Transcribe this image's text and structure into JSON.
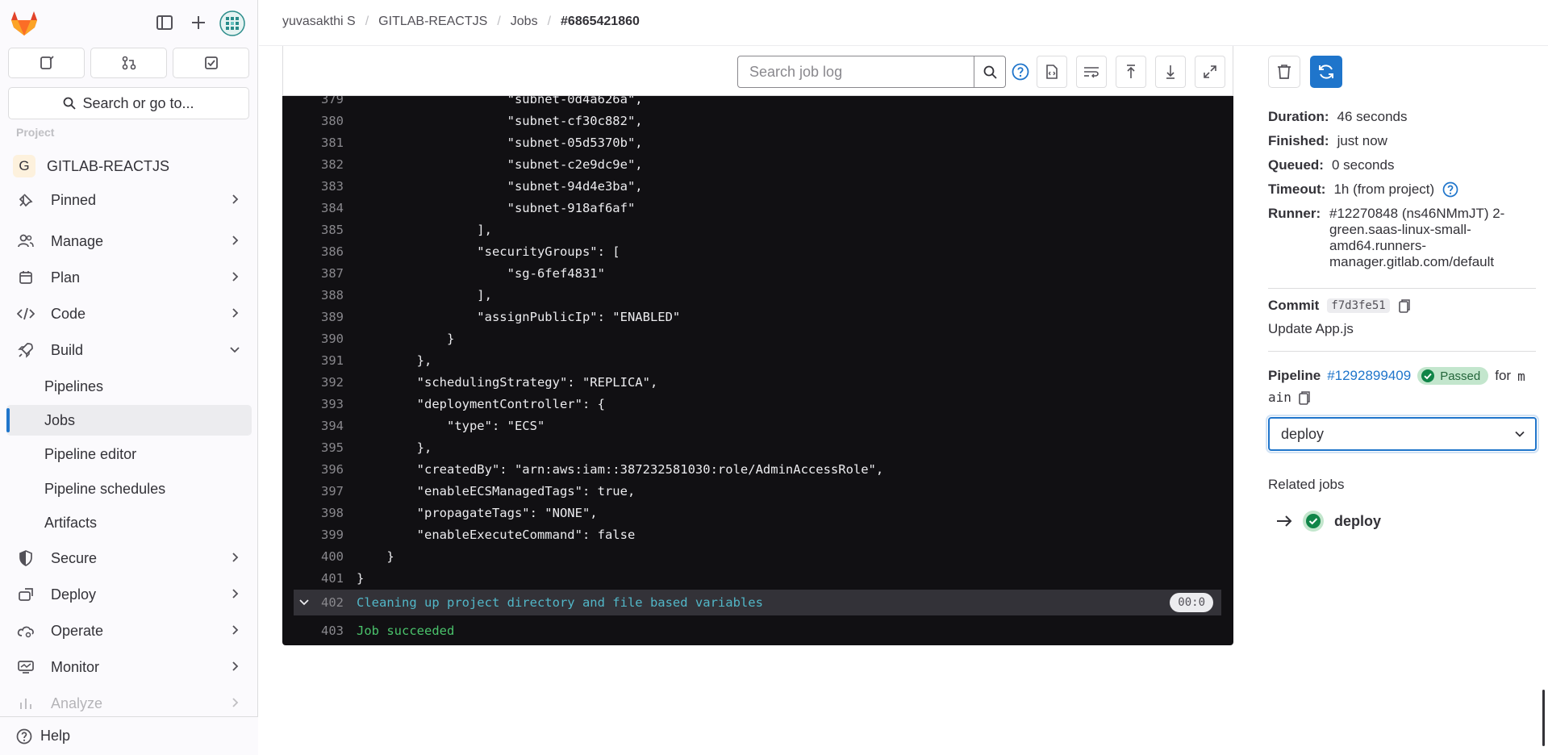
{
  "breadcrumb": [
    "yuvasakthi S",
    "GITLAB-REACTJS",
    "Jobs",
    "#6865421860"
  ],
  "sidebar": {
    "search_label": "Search or go to...",
    "section_faded": "Project",
    "project": {
      "avatar": "G",
      "name": "GITLAB-REACTJS"
    },
    "items": [
      {
        "label": "Pinned",
        "icon": "pin-icon"
      },
      {
        "label": "Manage",
        "icon": "users-icon"
      },
      {
        "label": "Plan",
        "icon": "calendar-icon"
      },
      {
        "label": "Code",
        "icon": "code-icon"
      },
      {
        "label": "Build",
        "icon": "rocket-icon"
      },
      {
        "label": "Secure",
        "icon": "shield-icon"
      },
      {
        "label": "Deploy",
        "icon": "deploy-icon"
      },
      {
        "label": "Operate",
        "icon": "cloud-gear-icon"
      },
      {
        "label": "Monitor",
        "icon": "monitor-icon"
      },
      {
        "label": "Analyze",
        "icon": "chart-icon"
      }
    ],
    "build_sub": [
      "Pipelines",
      "Jobs",
      "Pipeline editor",
      "Pipeline schedules",
      "Artifacts"
    ],
    "help_label": "Help"
  },
  "log": {
    "search_placeholder": "Search job log",
    "lines": [
      {
        "n": "379",
        "t": "                    \"subnet-0d4a626a\","
      },
      {
        "n": "380",
        "t": "                    \"subnet-cf30c882\","
      },
      {
        "n": "381",
        "t": "                    \"subnet-05d5370b\","
      },
      {
        "n": "382",
        "t": "                    \"subnet-c2e9dc9e\","
      },
      {
        "n": "383",
        "t": "                    \"subnet-94d4e3ba\","
      },
      {
        "n": "384",
        "t": "                    \"subnet-918af6af\""
      },
      {
        "n": "385",
        "t": "                ],"
      },
      {
        "n": "386",
        "t": "                \"securityGroups\": ["
      },
      {
        "n": "387",
        "t": "                    \"sg-6fef4831\""
      },
      {
        "n": "388",
        "t": "                ],"
      },
      {
        "n": "389",
        "t": "                \"assignPublicIp\": \"ENABLED\""
      },
      {
        "n": "390",
        "t": "            }"
      },
      {
        "n": "391",
        "t": "        },"
      },
      {
        "n": "392",
        "t": "        \"schedulingStrategy\": \"REPLICA\","
      },
      {
        "n": "393",
        "t": "        \"deploymentController\": {"
      },
      {
        "n": "394",
        "t": "            \"type\": \"ECS\""
      },
      {
        "n": "395",
        "t": "        },"
      },
      {
        "n": "396",
        "t": "        \"createdBy\": \"arn:aws:iam::387232581030:role/AdminAccessRole\","
      },
      {
        "n": "397",
        "t": "        \"enableECSManagedTags\": true,"
      },
      {
        "n": "398",
        "t": "        \"propagateTags\": \"NONE\","
      },
      {
        "n": "399",
        "t": "        \"enableExecuteCommand\": false"
      },
      {
        "n": "400",
        "t": "    }"
      },
      {
        "n": "401",
        "t": "}"
      }
    ],
    "section": {
      "n": "402",
      "t": "Cleaning up project directory and file based variables",
      "timer": "00:0"
    },
    "final": {
      "n": "403",
      "t": "Job succeeded"
    }
  },
  "job": {
    "duration_label": "Duration:",
    "duration": "46 seconds",
    "finished_label": "Finished:",
    "finished": "just now",
    "queued_label": "Queued:",
    "queued": "0 seconds",
    "timeout_label": "Timeout:",
    "timeout": "1h (from project)",
    "runner_label": "Runner:",
    "runner": "#12270848 (ns46NMmJT) 2-green.saas-linux-small-amd64.runners-manager.gitlab.com/default",
    "commit_label": "Commit",
    "commit_sha": "f7d3fe51",
    "commit_message": "Update App.js",
    "pipeline_label": "Pipeline",
    "pipeline_id": "#1292899409",
    "pipeline_status": "Passed",
    "for_label": "for",
    "branch_part1": "m",
    "branch_part2": "ain",
    "stage": "deploy",
    "related_title": "Related jobs",
    "related_job": "deploy"
  },
  "colors": {
    "accent": "#1f75cb",
    "success": "#108548",
    "log_bg": "#111013"
  }
}
